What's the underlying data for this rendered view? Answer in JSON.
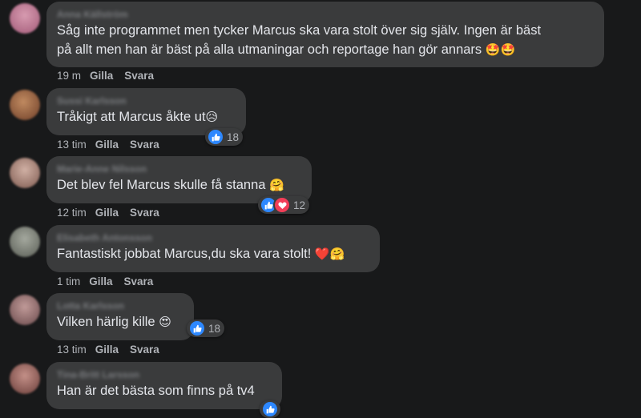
{
  "comments": [
    {
      "text": "Såg inte programmet men tycker Marcus ska vara stolt över sig själv. Ingen är bäst",
      "text2": "på allt men han är bäst på alla utmaningar och reportage han gör annars",
      "emoji": "🤩🤩",
      "time": "19 m",
      "like": "Gilla",
      "reply": "Svara",
      "avatar_color": "#b56a86"
    },
    {
      "text": "Tråkigt att Marcus åkte ut",
      "emoji": "😥",
      "time": "13 tim",
      "like": "Gilla",
      "reply": "Svara",
      "reaction_count": "18",
      "avatar_color": "#8a5a3c"
    },
    {
      "text": "Det blev fel Marcus skulle få stanna",
      "emoji": "🤗",
      "time": "12 tim",
      "like": "Gilla",
      "reply": "Svara",
      "reaction_count": "12",
      "avatar_color": "#9a7a70"
    },
    {
      "text": "Fantastiskt jobbat Marcus,du ska vara stolt!",
      "emoji": "❤️🤗",
      "time": "1 tim",
      "like": "Gilla",
      "reply": "Svara",
      "avatar_color": "#7c8078"
    },
    {
      "text": "Vilken härlig kille",
      "emoji": "😍",
      "time": "13 tim",
      "like": "Gilla",
      "reply": "Svara",
      "reaction_count": "18",
      "avatar_color": "#8a6a6c"
    },
    {
      "text": "Han är det bästa som finns på tv4",
      "avatar_color": "#90605c"
    }
  ],
  "colors": {
    "background": "#18191a",
    "bubble": "#3a3b3c",
    "like_blue": "#2d88ff",
    "love_red": "#f33e58"
  },
  "icons": [
    "thumbs-up-icon",
    "heart-icon"
  ]
}
